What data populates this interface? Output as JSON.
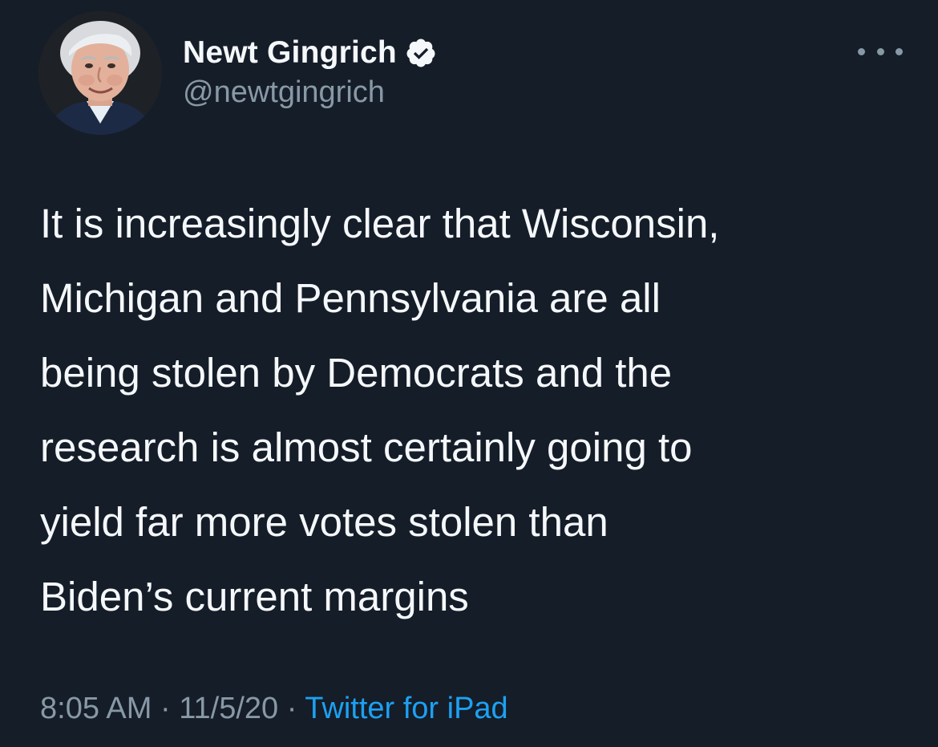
{
  "colors": {
    "background": "#151d29",
    "text": "#f5f8fa",
    "secondary": "#8899a6",
    "link": "#1da1f2"
  },
  "author": {
    "display_name": "Newt Gingrich",
    "handle": "@newtgingrich",
    "verified_icon": "verified-badge-icon",
    "avatar_icon": "avatar-photo"
  },
  "tweet": {
    "lines": [
      "It is increasingly clear that Wisconsin,",
      "Michigan and Pennsylvania are all",
      "being stolen by Democrats and the",
      "research is almost certainly going to",
      "yield far more votes stolen than",
      "Biden’s current margins"
    ]
  },
  "meta": {
    "time": "8:05 AM",
    "separator": " · ",
    "date": "11/5/20",
    "source": "Twitter for iPad"
  },
  "menu_icon": "more-options-icon"
}
